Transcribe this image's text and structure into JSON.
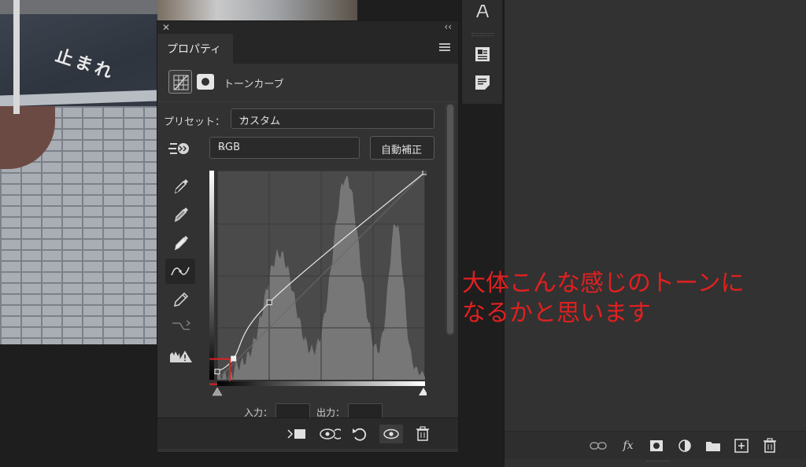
{
  "photo": {
    "road_marking": "止まれ"
  },
  "panel": {
    "close_glyph": "✕",
    "collapse_glyph": "‹‹",
    "tab_label": "プロパティ",
    "adjustment_label": "トーンカーブ",
    "preset_label": "プリセット：",
    "preset_value": "カスタム",
    "channel_value": "RGB",
    "auto_button": "自動補正",
    "input_label": "入力：",
    "output_label": "出力：",
    "input_value": "",
    "output_value": ""
  },
  "curve": {
    "points": [
      [
        0,
        10
      ],
      [
        20,
        26
      ],
      [
        64,
        95
      ],
      [
        255,
        255
      ]
    ],
    "highlighted_point_index": 0,
    "colors": {
      "highlight_box": "#e02020",
      "curve": "#e8e8e8",
      "histogram": "#7a7a7a",
      "graph_bg": "#4a4a4a"
    }
  },
  "annotation": {
    "line1": "大体こんな感じのトーンに",
    "line2": "なるかと思います",
    "color": "#e02020"
  },
  "tools": [
    "point-curve-tool",
    "eyedropper-black",
    "eyedropper-gray",
    "eyedropper-white",
    "curve-smooth-tool",
    "pencil-tool",
    "smooth-curve-icon",
    "clipping-warning-icon"
  ],
  "layers_footer": {
    "fx_label": "fx"
  }
}
